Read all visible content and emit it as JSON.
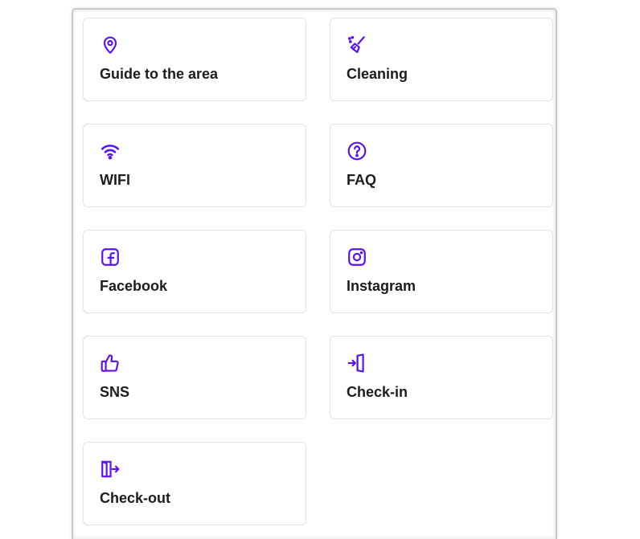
{
  "accent_color": "#5b12f0",
  "items": [
    {
      "label": "Guide to the area",
      "icon": "map-pin-icon"
    },
    {
      "label": "Cleaning",
      "icon": "broom-icon"
    },
    {
      "label": "WIFI",
      "icon": "wifi-icon"
    },
    {
      "label": "FAQ",
      "icon": "question-circle-icon"
    },
    {
      "label": "Facebook",
      "icon": "facebook-icon"
    },
    {
      "label": "Instagram",
      "icon": "instagram-icon"
    },
    {
      "label": "SNS",
      "icon": "thumbs-up-icon"
    },
    {
      "label": "Check-in",
      "icon": "door-enter-icon"
    },
    {
      "label": "Check-out",
      "icon": "door-exit-icon"
    }
  ]
}
